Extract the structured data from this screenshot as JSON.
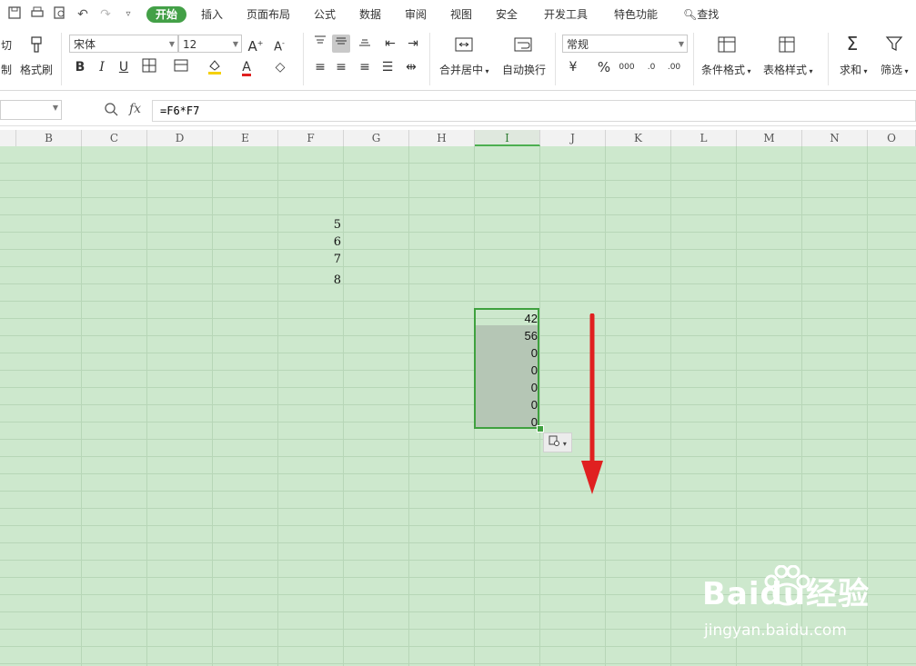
{
  "menubar": {
    "tabs": [
      "开始",
      "插入",
      "页面布局",
      "公式",
      "数据",
      "审阅",
      "视图",
      "安全",
      "开发工具",
      "特色功能"
    ],
    "search_label": "查找"
  },
  "ribbon": {
    "cut_label": "切",
    "copy_label": "制",
    "format_painter_label": "格式刷",
    "font_name": "宋体",
    "font_size": "12",
    "number_format": "常规",
    "merge_center_label": "合并居中",
    "wrap_text_label": "自动换行",
    "conditional_format_label": "条件格式",
    "table_style_label": "表格样式",
    "sum_label": "求和",
    "filter_label": "筛选",
    "bold": "B",
    "italic": "I",
    "underline": "U",
    "font_color": "A",
    "percent": "%",
    "thousands": "000",
    "inc_decimal": ".0",
    "dec_decimal": ".00"
  },
  "formula_bar": {
    "fx_label": "fx",
    "formula": "=F6*F7"
  },
  "columns": [
    "B",
    "C",
    "D",
    "E",
    "F",
    "G",
    "H",
    "I",
    "J",
    "K",
    "L",
    "M",
    "N",
    "O"
  ],
  "active_column": "I",
  "cells_f": [
    "5",
    "6",
    "7",
    "8"
  ],
  "results_i": [
    "42",
    "56",
    "0",
    "0",
    "0",
    "0",
    "0"
  ],
  "watermark": {
    "brand": "Baidu经验",
    "url": "jingyan.baidu.com"
  },
  "colors": {
    "accent": "#43a047",
    "grid_bg": "#cde8cd",
    "selection_border": "#3fa13f",
    "arrow": "#e02020"
  },
  "icons": {
    "arrow": "red-down-arrow"
  }
}
